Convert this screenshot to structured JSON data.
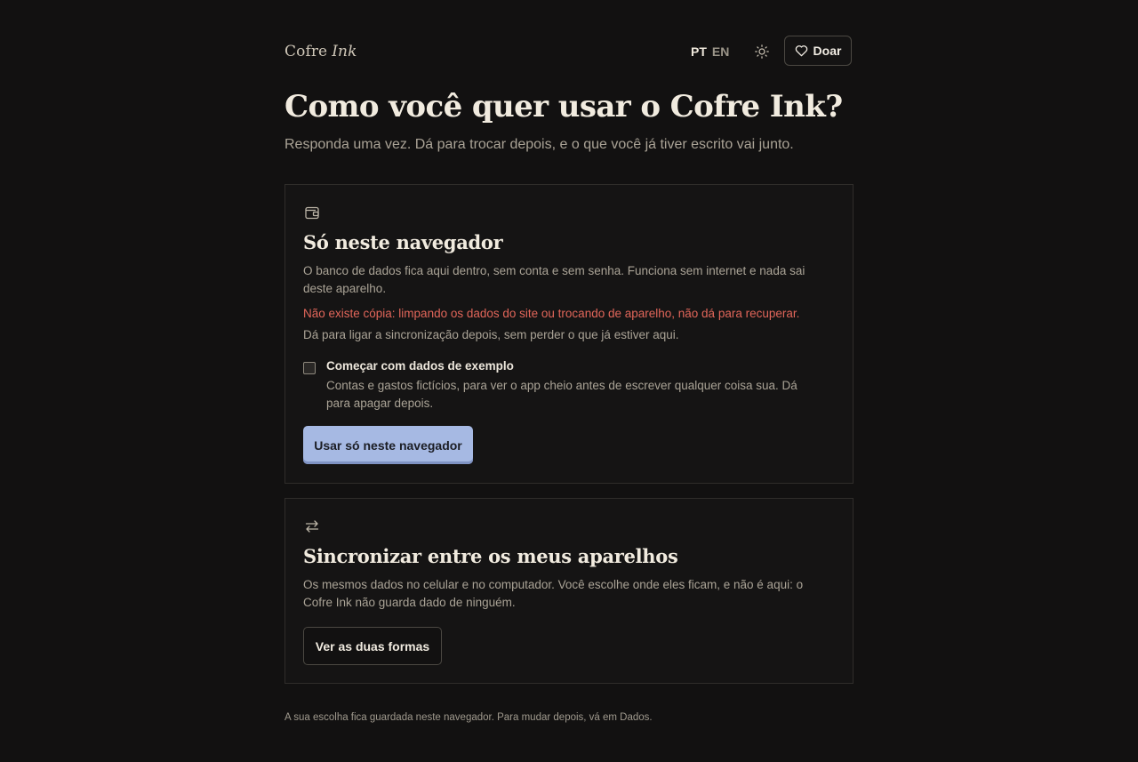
{
  "header": {
    "brand": "Cofre",
    "brand_italic": "Ink",
    "languages": [
      {
        "code": "PT",
        "active": true
      },
      {
        "code": "EN",
        "active": false
      }
    ],
    "theme_icon": "sun-icon",
    "donate_icon": "heart-icon",
    "donate_label": "Doar"
  },
  "main": {
    "title": "Como você quer usar o Cofre Ink?",
    "subtitle": "Responda uma vez. Dá para trocar depois, e o que você já tiver escrito vai junto."
  },
  "local_card": {
    "icon": "wallet-icon",
    "title": "Só neste navegador",
    "description": "O banco de dados fica aqui dentro, sem conta e sem senha. Funciona sem internet e nada sai deste aparelho.",
    "warning": "Não existe cópia: limpando os dados do site ou trocando de aparelho, não dá para recuperar.",
    "note": "Dá para ligar a sincronização depois, sem perder o que já estiver aqui.",
    "sample_data": {
      "checked": false,
      "title": "Começar com dados de exemplo",
      "description": "Contas e gastos fictícios, para ver o app cheio antes de escrever qualquer coisa sua. Dá para apagar depois."
    },
    "button_label": "Usar só neste navegador",
    "accent_color": "#a6b9e3",
    "warning_color": "#e2665a"
  },
  "sync_card": {
    "icon": "arrows-exchange-icon",
    "title": "Sincronizar entre os meus aparelhos",
    "description": "Os mesmos dados no celular e no computador. Você escolhe onde eles ficam, e não é aqui: o Cofre Ink não guarda dado de ninguém.",
    "button_label": "Ver as duas formas"
  },
  "footer": {
    "note": "A sua escolha fica guardada neste navegador. Para mudar depois, vá em Dados."
  }
}
